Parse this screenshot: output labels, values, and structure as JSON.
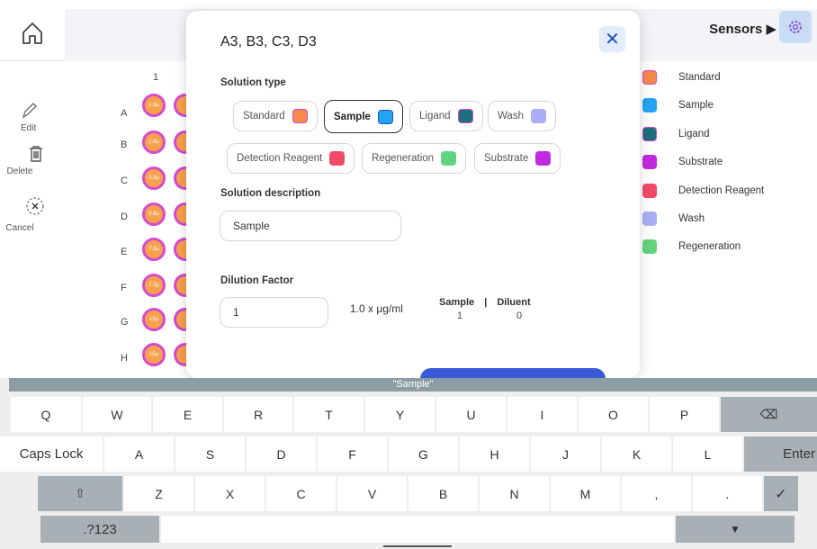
{
  "header": {
    "sensors_label": "Sensors ▶"
  },
  "tools": {
    "edit": "Edit",
    "delete": "Delete",
    "cancel": "Cancel"
  },
  "plate": {
    "column": "1",
    "rows": [
      "A",
      "B",
      "C",
      "D",
      "E",
      "F",
      "G",
      "H"
    ],
    "wells": [
      "1.9μ",
      "1.9μ",
      "3.8μ",
      "3.8μ",
      "7.5μ",
      "7.5μ",
      "15μ",
      "15μ"
    ]
  },
  "legend": [
    {
      "label": "Standard",
      "color": "#f68a4c"
    },
    {
      "label": "Sample",
      "color": "#25a3f3"
    },
    {
      "label": "Ligand",
      "color": "#1f6e7c"
    },
    {
      "label": "Substrate",
      "color": "#c12ae0"
    },
    {
      "label": "Detection Reagent",
      "color": "#f04a66"
    },
    {
      "label": "Wash",
      "color": "#a9aef6"
    },
    {
      "label": "Regeneration",
      "color": "#62d47f"
    }
  ],
  "modal": {
    "title": "A3, B3, C3, D3",
    "solution_type_label": "Solution type",
    "solution_types": [
      {
        "label": "Standard",
        "color": "#f68a4c"
      },
      {
        "label": "Sample",
        "color": "#25a3f3",
        "selected": true
      },
      {
        "label": "Ligand",
        "color": "#1f6e7c"
      },
      {
        "label": "Wash",
        "color": "#a9aef6"
      },
      {
        "label": "Detection Reagent",
        "color": "#f04a66"
      },
      {
        "label": "Regeneration",
        "color": "#62d47f"
      },
      {
        "label": "Substrate",
        "color": "#c12ae0"
      }
    ],
    "description_label": "Solution description",
    "description_value": "Sample",
    "dilution_label": "Dilution Factor",
    "dilution_value": "1",
    "factor_text": "1.0 x μg/ml",
    "ratio": {
      "sample_label": "Sample",
      "sep": "|",
      "diluent_label": "Diluent",
      "sample_value": "1",
      "diluent_value": "0"
    }
  },
  "keyboard": {
    "preview": "\"Sample\"",
    "row1": [
      "Q",
      "W",
      "E",
      "R",
      "T",
      "Y",
      "U",
      "I",
      "O",
      "P",
      "⌫"
    ],
    "row2": [
      "Caps Lock",
      "A",
      "S",
      "D",
      "F",
      "G",
      "H",
      "J",
      "K",
      "L",
      "Enter"
    ],
    "row3": [
      "⇧",
      "Z",
      "X",
      "C",
      "V",
      "B",
      "N",
      "M",
      ",",
      ".",
      "✓"
    ],
    "row4": [
      ".?123",
      "",
      "▼"
    ]
  }
}
